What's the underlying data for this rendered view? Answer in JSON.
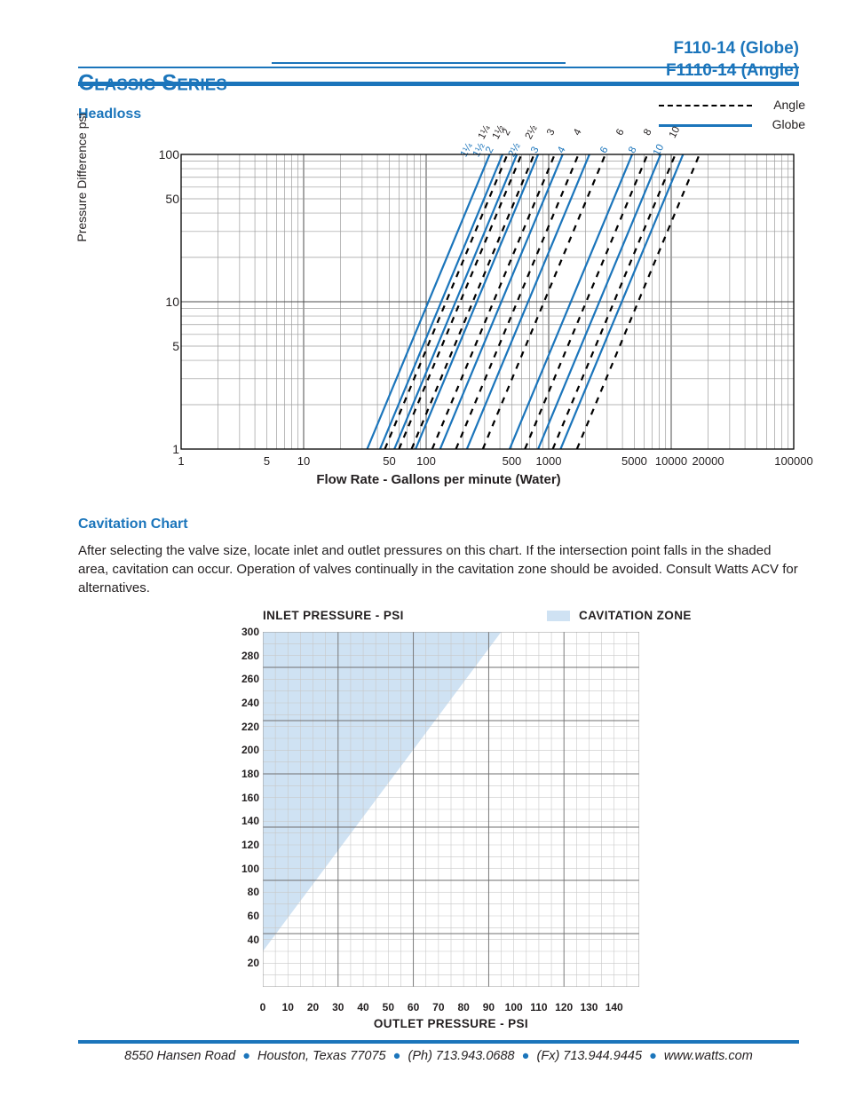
{
  "header": {
    "brand": "Classic Series",
    "brand_word1_cap": "C",
    "brand_word1_rest": "LASSIC",
    "brand_word2_cap": "S",
    "brand_word2_rest": "ERIES",
    "model_globe": "F110-14 (Globe)",
    "model_angle": "F1110-14 (Angle)",
    "accent_color": "#1b75bb"
  },
  "headloss": {
    "title": "Headloss",
    "legend": [
      {
        "label": "Angle",
        "style": "dashed",
        "color": "#000000"
      },
      {
        "label": "Globe",
        "style": "solid",
        "color": "#1b75bb"
      }
    ]
  },
  "cavitation": {
    "title": "Cavitation Chart",
    "body": "After selecting the valve size, locate inlet and outlet pressures on this chart. If the intersection point falls in the shaded area, cavitation can occur. Operation of valves continually in the cavitation zone should be avoided. Consult Watts ACV for alternatives.",
    "inlet_header": "INLET PRESSURE - PSI",
    "zone_label": "CAVITATION ZONE",
    "zone_color": "#cfe2f3"
  },
  "footer": {
    "address": "8550 Hansen Road",
    "city": "Houston, Texas 77075",
    "phone": "(Ph) 713.943.0688",
    "fax": "(Fx) 713.944.9445",
    "web": "www.watts.com"
  },
  "chart_data": [
    {
      "type": "line",
      "name": "headloss",
      "title": "Headloss",
      "xlabel": "Flow Rate - Gallons per minute (Water)",
      "ylabel": "Pressure Difference psi",
      "xscale": "log",
      "yscale": "log",
      "xlim": [
        1,
        100000
      ],
      "ylim": [
        1,
        100
      ],
      "xticks": [
        1,
        5,
        10,
        50,
        100,
        500,
        1000,
        5000,
        10000,
        20000,
        100000
      ],
      "xtick_labels": [
        "1",
        "5",
        "10",
        "50",
        "100",
        "500",
        "1000",
        "5000",
        "10000",
        "20000",
        "100000"
      ],
      "yticks": [
        1,
        5,
        10,
        50,
        100
      ],
      "ytick_labels": [
        "1",
        "5",
        "10",
        "50",
        "100"
      ],
      "grid": true,
      "legend": [
        "Angle",
        "Globe"
      ],
      "legend_position": "top-right",
      "valve_sizes": [
        "1¼",
        "1½",
        "2",
        "2½",
        "3",
        "4",
        "6",
        "8",
        "10"
      ],
      "slope_loglog": 2.0,
      "series": [
        {
          "name": "Globe 1¼",
          "style": "solid",
          "color": "#1b75bb",
          "flow_at_1psi": 33,
          "flow_at_100psi": 330
        },
        {
          "name": "Globe 1½",
          "style": "solid",
          "color": "#1b75bb",
          "flow_at_1psi": 42,
          "flow_at_100psi": 420
        },
        {
          "name": "Globe 2",
          "style": "solid",
          "color": "#1b75bb",
          "flow_at_1psi": 55,
          "flow_at_100psi": 550
        },
        {
          "name": "Globe 2½",
          "style": "solid",
          "color": "#1b75bb",
          "flow_at_1psi": 82,
          "flow_at_100psi": 820
        },
        {
          "name": "Globe 3",
          "style": "solid",
          "color": "#1b75bb",
          "flow_at_1psi": 130,
          "flow_at_100psi": 1300
        },
        {
          "name": "Globe 4",
          "style": "solid",
          "color": "#1b75bb",
          "flow_at_1psi": 215,
          "flow_at_100psi": 2150
        },
        {
          "name": "Globe 6",
          "style": "solid",
          "color": "#1b75bb",
          "flow_at_1psi": 480,
          "flow_at_100psi": 4800
        },
        {
          "name": "Globe 8",
          "style": "solid",
          "color": "#1b75bb",
          "flow_at_1psi": 820,
          "flow_at_100psi": 8200
        },
        {
          "name": "Globe 10",
          "style": "solid",
          "color": "#1b75bb",
          "flow_at_1psi": 1250,
          "flow_at_100psi": 12500
        },
        {
          "name": "Angle 1¼",
          "style": "dashed",
          "color": "#000000",
          "flow_at_1psi": 46,
          "flow_at_100psi": 460
        },
        {
          "name": "Angle 1½",
          "style": "dashed",
          "color": "#000000",
          "flow_at_1psi": 60,
          "flow_at_100psi": 600
        },
        {
          "name": "Angle 2",
          "style": "dashed",
          "color": "#000000",
          "flow_at_1psi": 76,
          "flow_at_100psi": 760
        },
        {
          "name": "Angle 2½",
          "style": "dashed",
          "color": "#000000",
          "flow_at_1psi": 112,
          "flow_at_100psi": 1120
        },
        {
          "name": "Angle 3",
          "style": "dashed",
          "color": "#000000",
          "flow_at_1psi": 175,
          "flow_at_100psi": 1750
        },
        {
          "name": "Angle 4",
          "style": "dashed",
          "color": "#000000",
          "flow_at_1psi": 290,
          "flow_at_100psi": 2900
        },
        {
          "name": "Angle 6",
          "style": "dashed",
          "color": "#000000",
          "flow_at_1psi": 640,
          "flow_at_100psi": 6400
        },
        {
          "name": "Angle 8",
          "style": "dashed",
          "color": "#000000",
          "flow_at_1psi": 1080,
          "flow_at_100psi": 10800
        },
        {
          "name": "Angle 10",
          "style": "dashed",
          "color": "#000000",
          "flow_at_1psi": 1700,
          "flow_at_100psi": 17000
        }
      ]
    },
    {
      "type": "area",
      "name": "cavitation",
      "title": "Cavitation Chart",
      "xlabel": "OUTLET PRESSURE - PSI",
      "ylabel": "INLET PRESSURE - PSI",
      "xlim": [
        0,
        150
      ],
      "ylim": [
        0,
        300
      ],
      "xticks": [
        0,
        10,
        20,
        30,
        40,
        50,
        60,
        70,
        80,
        90,
        100,
        110,
        120,
        130,
        140
      ],
      "yticks": [
        20,
        40,
        60,
        80,
        100,
        120,
        140,
        160,
        180,
        200,
        220,
        240,
        260,
        280,
        300
      ],
      "grid": true,
      "minor_grid_x": 5,
      "minor_grid_y": 10,
      "zone_label": "CAVITATION ZONE",
      "zone_color": "#cfe2f3",
      "zone_polygon": [
        [
          0,
          30
        ],
        [
          0,
          300
        ],
        [
          95,
          300
        ]
      ],
      "zone_boundary_note": "Cavitation occurs above/left of the line from (0,30) to (95,300)"
    }
  ]
}
